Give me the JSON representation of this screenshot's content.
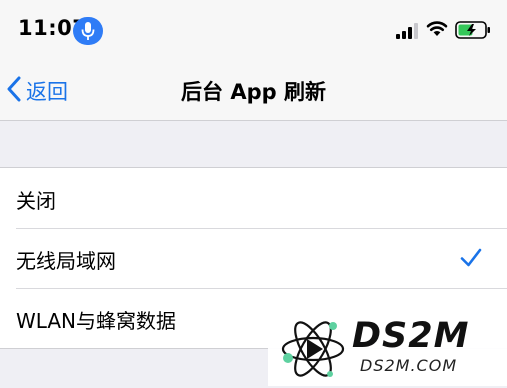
{
  "status_bar": {
    "time": "11:07",
    "mic_icon": "mic-icon",
    "signal_icon": "cellular-signal-icon",
    "wifi_icon": "wifi-icon",
    "battery_icon": "battery-charging-icon",
    "colors": {
      "mic_pill": "#2f7cf6",
      "battery_fill": "#34c759"
    }
  },
  "nav": {
    "back_label": "返回",
    "back_icon": "chevron-left-icon",
    "title": "后台 App 刷新",
    "accent": "#1a73e8"
  },
  "options": [
    {
      "label": "关闭",
      "selected": false
    },
    {
      "label": "无线局域网",
      "selected": true
    },
    {
      "label": "WLAN与蜂窝数据",
      "selected": false
    }
  ],
  "checkmark_icon": "checkmark-icon",
  "watermark": {
    "title": "DS2M",
    "url": "DS2M.COM"
  }
}
